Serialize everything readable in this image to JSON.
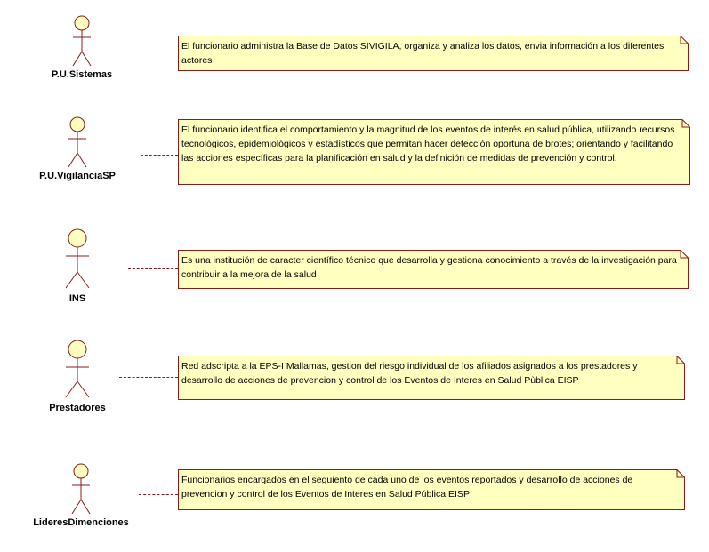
{
  "diagram": {
    "colors": {
      "actor_fill": "#ffffc0",
      "actor_stroke": "#8a1a1a",
      "note_fill": "#ffffc0",
      "note_stroke": "#8a1a1a",
      "connector": "#8a1a1a"
    },
    "rows": [
      {
        "actor": "P.U.Sistemas",
        "note": "El funcionario administra la Base de Datos SIVIGILA, organiza y analiza los datos, envia información a los diferentes actores"
      },
      {
        "actor": "P.U.VigilanciaSP",
        "note": "El funcionario identifica el comportamiento y la magnitud de los eventos de interés en salud pública, utilizando recursos tecnológicos, epidemiológicos y estadísticos que permitan hacer detección oportuna de brotes; orientando y facilitando las acciones específicas para la planificación en salud y la definición de medidas de prevención y control."
      },
      {
        "actor": "INS",
        "note": "Es una institución de caracter científico técnico que desarrolla y gestiona conocimiento a través de la investigación para contribuir a la mejora de la salud"
      },
      {
        "actor": "Prestadores",
        "note": "Red adscripta a la EPS-I Mallamas, gestion del riesgo individual de los afiliados asignados a los prestadores y desarrollo de acciones de prevencion y control de los Eventos de Interes en Salud Pùblica EISP"
      },
      {
        "actor": "LideresDimenciones",
        "note": "Funcionarios encargados en el seguiento de cada uno de los eventos reportados y desarrollo de acciones de prevencion y control de los Eventos de Interes en Salud Pública EISP"
      }
    ]
  }
}
